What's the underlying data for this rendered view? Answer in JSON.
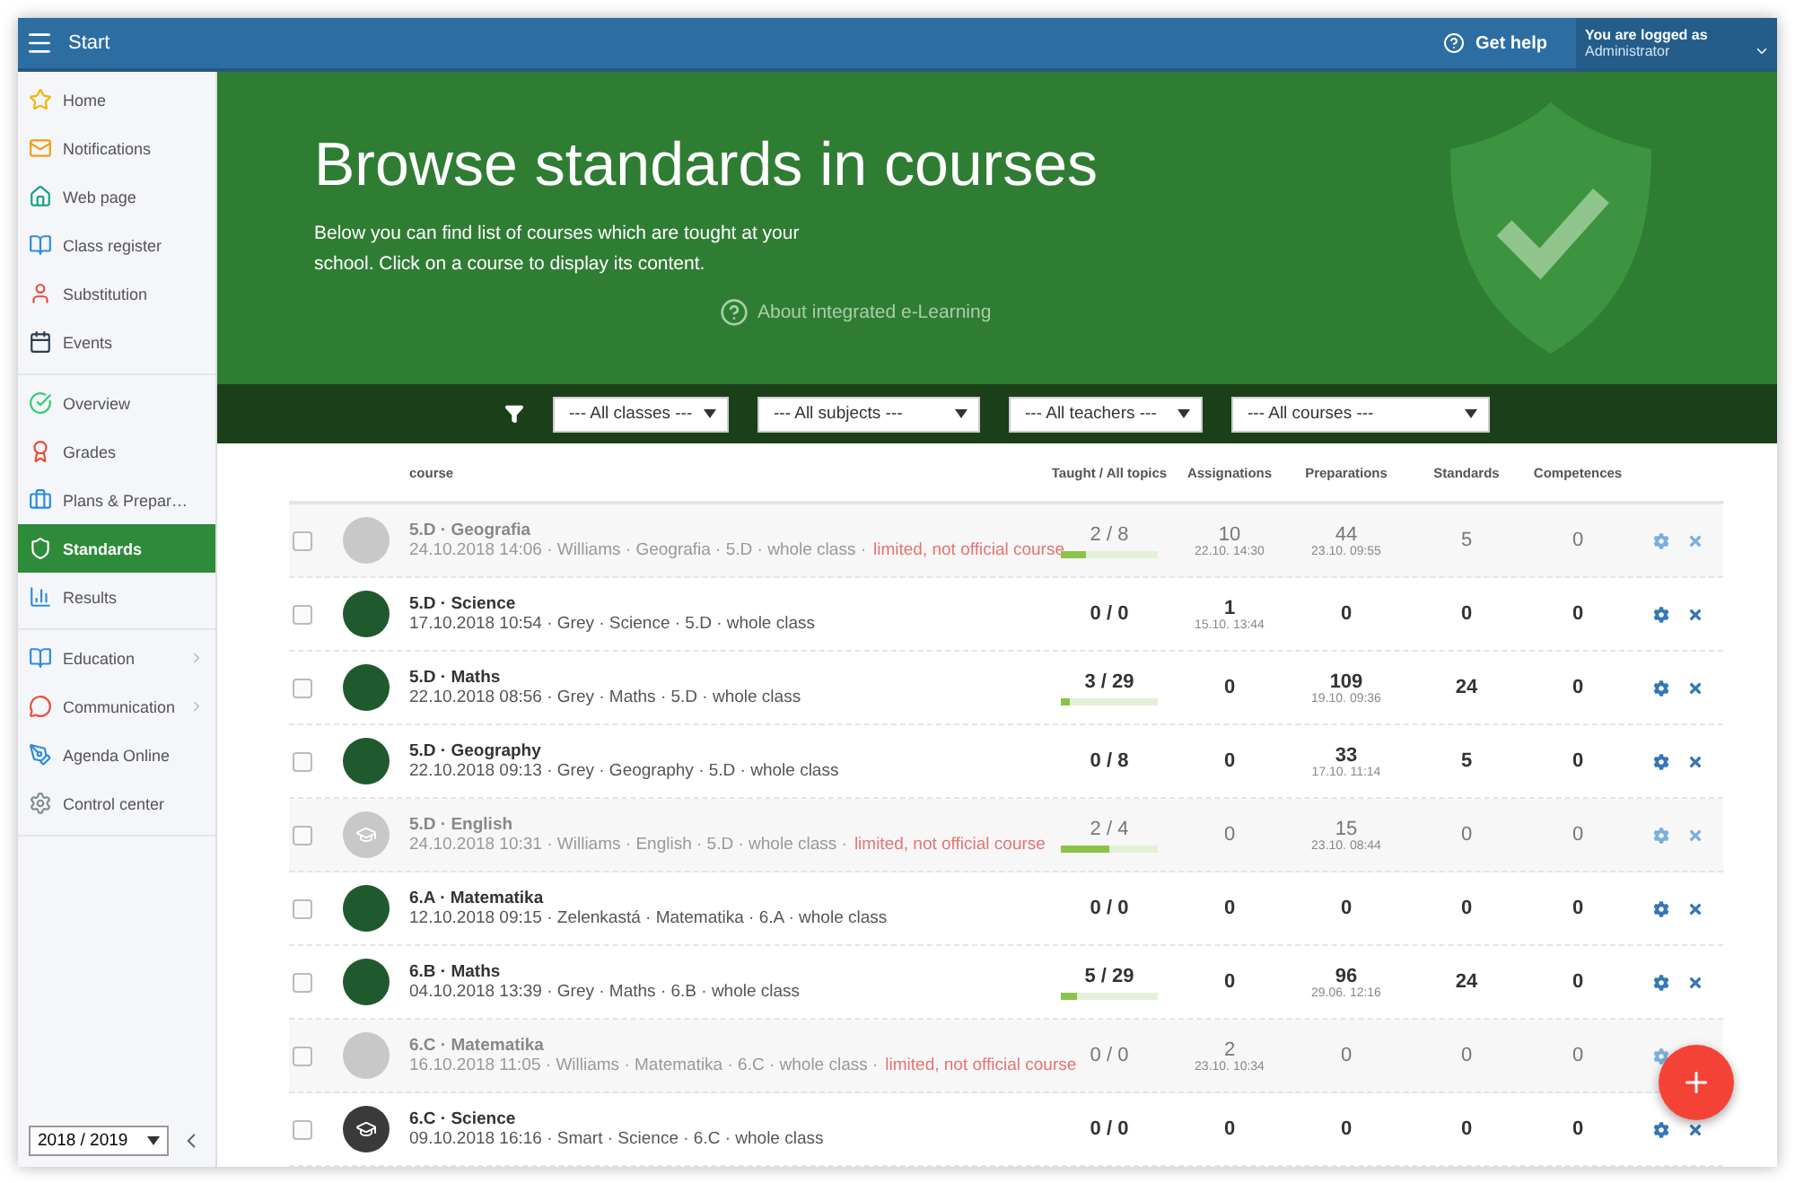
{
  "topbar": {
    "title": "Start",
    "help": "Get help",
    "user_label": "You are logged as",
    "user_name": "Administrator"
  },
  "sidebar": {
    "groups": [
      [
        {
          "label": "Home",
          "selected": false,
          "submenu": false
        },
        {
          "label": "Notifications",
          "selected": false,
          "submenu": false
        },
        {
          "label": "Web page",
          "selected": false,
          "submenu": false
        },
        {
          "label": "Class register",
          "selected": false,
          "submenu": false
        },
        {
          "label": "Substitution",
          "selected": false,
          "submenu": false
        },
        {
          "label": "Events",
          "selected": false,
          "submenu": false
        }
      ],
      [
        {
          "label": "Overview",
          "selected": false,
          "submenu": false
        },
        {
          "label": "Grades",
          "selected": false,
          "submenu": false
        },
        {
          "label": "Plans & Prepar…",
          "selected": false,
          "submenu": false
        },
        {
          "label": "Standards",
          "selected": true,
          "submenu": false
        },
        {
          "label": "Results",
          "selected": false,
          "submenu": false
        }
      ],
      [
        {
          "label": "Education",
          "selected": false,
          "submenu": true
        },
        {
          "label": "Communication",
          "selected": false,
          "submenu": true
        },
        {
          "label": "Agenda Online",
          "selected": false,
          "submenu": false
        },
        {
          "label": "Control center",
          "selected": false,
          "submenu": false
        }
      ]
    ],
    "year": "2018 / 2019"
  },
  "hero": {
    "title": "Browse standards in courses",
    "text": "Below you can find list of courses which are tought at your school. Click on a course to display its content.",
    "link": "About integrated e-Learning"
  },
  "filters": [
    "--- All classes ---",
    "--- All subjects ---",
    "--- All teachers ---",
    "--- All courses ---"
  ],
  "table": {
    "columns": [
      "course",
      "Taught / All topics",
      "Assignations",
      "Preparations",
      "Standards",
      "Competences"
    ],
    "rows": [
      {
        "checked": false,
        "limited": true,
        "kind": "picture",
        "title": "5.D · Geografia",
        "meta": "24.10.2018 14:06 · Williams · Geografia · 5.D · whole class ·",
        "note": "limited, not official course",
        "taught": "2 / 8",
        "level": 0.25,
        "assignations": "10",
        "assign_time": "22.10. 14:30",
        "preparations": "44",
        "prep_time": "23.10. 09:55",
        "standards": "5",
        "competences": "0"
      },
      {
        "checked": false,
        "limited": false,
        "kind": "picture",
        "title": "5.D · Science",
        "meta": "17.10.2018 10:54 · Grey · Science · 5.D · whole class",
        "taught": "0 / 0",
        "assignations": "1",
        "assign_time": "15.10. 13:44",
        "preparations": "0",
        "standards": "0",
        "competences": "0"
      },
      {
        "checked": false,
        "limited": false,
        "kind": "picture",
        "title": "5.D · Maths",
        "meta": "22.10.2018 08:56 · Grey · Maths · 5.D · whole class",
        "taught": "3 / 29",
        "level": 0.1,
        "assignations": "0",
        "preparations": "109",
        "prep_time": "19.10. 09:36",
        "standards": "24",
        "competences": "0"
      },
      {
        "checked": false,
        "limited": false,
        "kind": "picture",
        "title": "5.D · Geography",
        "meta": "22.10.2018 09:13 · Grey · Geography · 5.D · whole class",
        "taught": "0 / 8",
        "assignations": "0",
        "preparations": "33",
        "prep_time": "17.10. 11:14",
        "standards": "5",
        "competences": "0"
      },
      {
        "checked": false,
        "limited": true,
        "kind": "cap",
        "title": "5.D · English",
        "meta": "24.10.2018 10:31 · Williams · English · 5.D · whole class ·",
        "note": "limited, not official course",
        "taught": "2 / 4",
        "level": 0.5,
        "assignations": "0",
        "preparations": "15",
        "prep_time": "23.10. 08:44",
        "standards": "0",
        "competences": "0"
      },
      {
        "checked": false,
        "limited": false,
        "kind": "picture",
        "title": "6.A · Matematika",
        "meta": "12.10.2018 09:15 · Zelenkastá · Matematika · 6.A · whole class",
        "taught": "0 / 0",
        "assignations": "0",
        "preparations": "0",
        "standards": "0",
        "competences": "0"
      },
      {
        "checked": false,
        "limited": false,
        "kind": "picture",
        "title": "6.B · Maths",
        "meta": "04.10.2018 13:39 · Grey · Maths · 6.B · whole class",
        "taught": "5 / 29",
        "level": 0.17,
        "assignations": "0",
        "preparations": "96",
        "prep_time": "29.06. 12:16",
        "standards": "24",
        "competences": "0"
      },
      {
        "checked": false,
        "limited": true,
        "kind": "picture",
        "title": "6.C · Matematika",
        "meta": "16.10.2018 11:05 · Williams · Matematika · 6.C · whole class ·",
        "note": "limited, not official course",
        "taught": "0 / 0",
        "assignations": "2",
        "assign_time": "23.10. 10:34",
        "preparations": "0",
        "standards": "0",
        "competences": "0"
      },
      {
        "checked": false,
        "limited": false,
        "kind": "cap",
        "title": "6.C · Science",
        "meta": "09.10.2018 16:16 · Smart · Science · 6.C · whole class",
        "taught": "0 / 0",
        "assignations": "0",
        "preparations": "0",
        "standards": "0",
        "competences": "0"
      }
    ]
  }
}
